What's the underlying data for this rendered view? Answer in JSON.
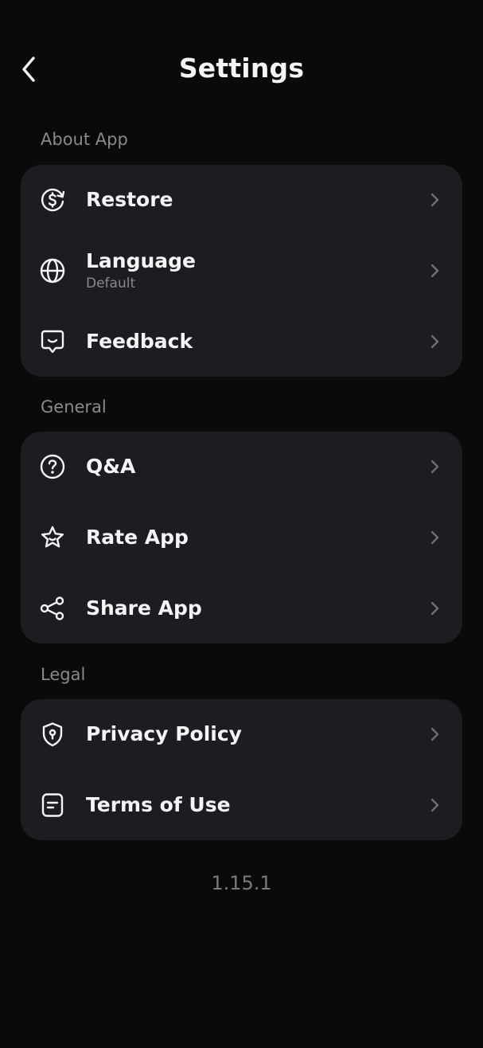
{
  "header": {
    "title": "Settings",
    "back_icon": "chevron-left-icon"
  },
  "sections": [
    {
      "label": "About App",
      "items": [
        {
          "label": "Restore",
          "subtitle": "",
          "icon": "dollar-refresh-icon"
        },
        {
          "label": "Language",
          "subtitle": "Default",
          "icon": "globe-icon"
        },
        {
          "label": "Feedback",
          "subtitle": "",
          "icon": "chat-smile-icon"
        }
      ]
    },
    {
      "label": "General",
      "items": [
        {
          "label": "Q&A",
          "subtitle": "",
          "icon": "question-circle-icon"
        },
        {
          "label": "Rate App",
          "subtitle": "",
          "icon": "star-icon"
        },
        {
          "label": "Share App",
          "subtitle": "",
          "icon": "share-icon"
        }
      ]
    },
    {
      "label": "Legal",
      "items": [
        {
          "label": "Privacy Policy",
          "subtitle": "",
          "icon": "shield-lock-icon"
        },
        {
          "label": "Terms of Use",
          "subtitle": "",
          "icon": "document-icon"
        }
      ]
    }
  ],
  "version": "1.15.1",
  "colors": {
    "background": "#0a0a0b",
    "card": "#1c1d20",
    "text_primary": "#f5f5f7",
    "text_secondary": "#8a8a8e",
    "chevron": "#6e6f73"
  }
}
